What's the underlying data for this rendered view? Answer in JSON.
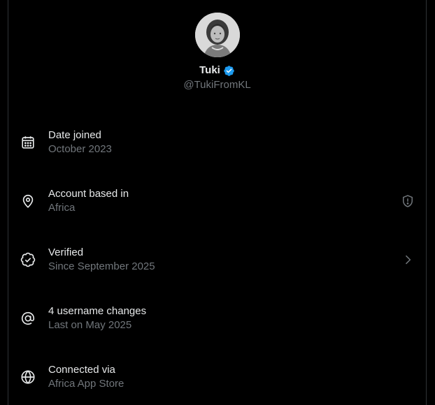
{
  "profile": {
    "name": "Tuki",
    "handle": "@TukiFromKL",
    "verified": true,
    "badge_color": "#1d9bf0"
  },
  "rows": [
    {
      "icon": "calendar-icon",
      "title": "Date joined",
      "subtitle": "October 2023",
      "trailing": null
    },
    {
      "icon": "location-pin-icon",
      "title": "Account based in",
      "subtitle": "Africa",
      "trailing": "shield-alert-icon"
    },
    {
      "icon": "verified-check-icon",
      "title": "Verified",
      "subtitle": "Since September 2025",
      "trailing": "chevron-right-icon"
    },
    {
      "icon": "at-sign-icon",
      "title": "4 username changes",
      "subtitle": "Last on May 2025",
      "trailing": null
    },
    {
      "icon": "globe-icon",
      "title": "Connected via",
      "subtitle": "Africa App Store",
      "trailing": null
    }
  ],
  "colors": {
    "background": "#000000",
    "text_primary": "#e7e9ea",
    "text_secondary": "#71767b",
    "border": "#2f3336"
  }
}
